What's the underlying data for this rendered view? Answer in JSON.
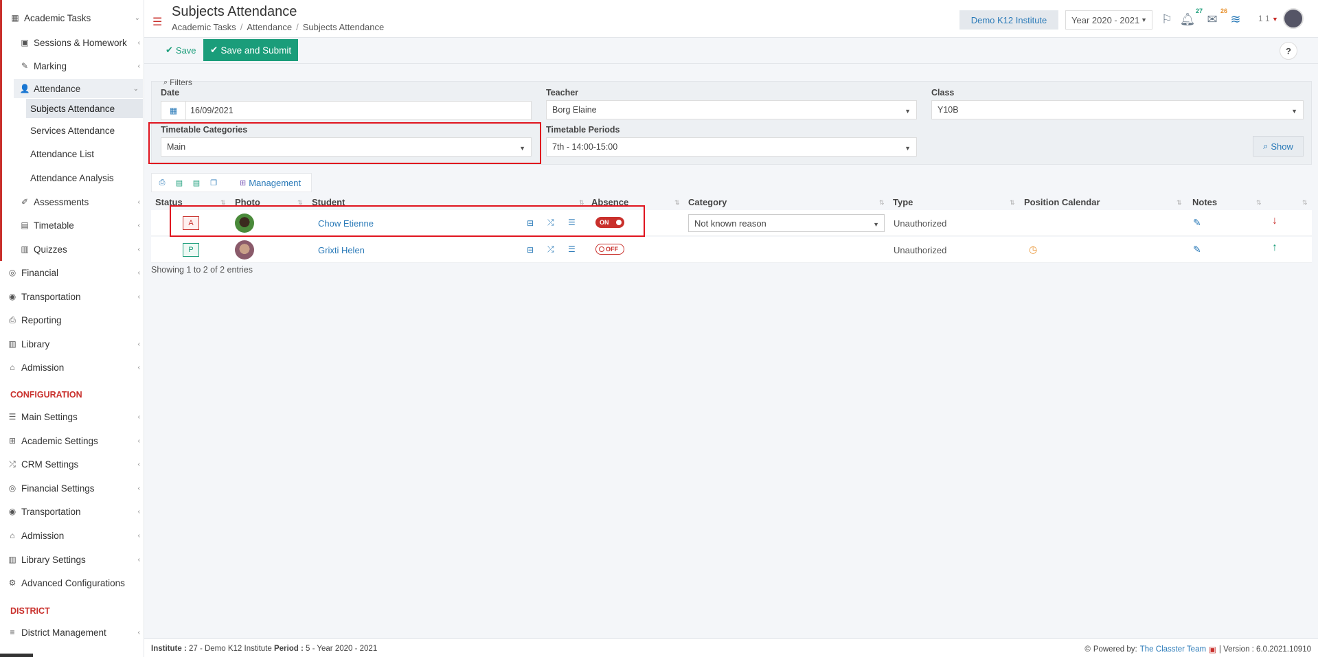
{
  "sidebar": {
    "items": [
      {
        "label": "Academic Tasks",
        "icon": "grid-icon"
      },
      {
        "label": "Sessions & Homework",
        "icon": "teacher-board-icon"
      },
      {
        "label": "Marking",
        "icon": "edit-icon"
      },
      {
        "label": "Attendance",
        "icon": "user-check-icon"
      },
      {
        "label": "Subjects Attendance"
      },
      {
        "label": "Services Attendance"
      },
      {
        "label": "Attendance List"
      },
      {
        "label": "Attendance Analysis"
      },
      {
        "label": "Assessments",
        "icon": "pencil-square-icon"
      },
      {
        "label": "Timetable",
        "icon": "table-icon"
      },
      {
        "label": "Quizzes",
        "icon": "quiz-icon"
      },
      {
        "label": "Financial",
        "icon": "coins-icon"
      },
      {
        "label": "Transportation",
        "icon": "bus-icon"
      },
      {
        "label": "Reporting",
        "icon": "printer-icon"
      },
      {
        "label": "Library",
        "icon": "books-icon"
      },
      {
        "label": "Admission",
        "icon": "building-icon"
      }
    ],
    "config_title": "CONFIGURATION",
    "config_items": [
      {
        "label": "Main Settings",
        "icon": "sliders-icon"
      },
      {
        "label": "Academic Settings",
        "icon": "hierarchy-icon"
      },
      {
        "label": "CRM Settings",
        "icon": "shuffle-icon"
      },
      {
        "label": "Financial Settings",
        "icon": "coins-icon"
      },
      {
        "label": "Transportation",
        "icon": "bus-icon"
      },
      {
        "label": "Admission",
        "icon": "building-icon"
      },
      {
        "label": "Library Settings",
        "icon": "books-icon"
      },
      {
        "label": "Advanced Configurations",
        "icon": "gears-icon"
      }
    ],
    "district_title": "DISTRICT",
    "district_items": [
      {
        "label": "District Management",
        "icon": "menu-icon"
      }
    ]
  },
  "header": {
    "title": "Subjects Attendance",
    "breadcrumb": [
      "Academic Tasks",
      "Attendance",
      "Subjects Attendance"
    ],
    "institute": "Demo K12 Institute",
    "year": "Year 2020 - 2021",
    "notif_count": "27",
    "mail_count": "26",
    "user_num": "1 1"
  },
  "actions": {
    "save": "Save",
    "save_submit": "Save and Submit",
    "help": "?"
  },
  "filters": {
    "title": "Filters",
    "date_label": "Date",
    "date_value": "16/09/2021",
    "teacher_label": "Teacher",
    "teacher_value": "Borg Elaine",
    "class_label": "Class",
    "class_value": "Y10B",
    "tt_categories_label": "Timetable Categories",
    "tt_categories_value": "Main",
    "tt_periods_label": "Timetable Periods",
    "tt_periods_value": "7th - 14:00-15:00",
    "show_button": "Show"
  },
  "table": {
    "management": "Management",
    "columns": [
      "Status",
      "Photo",
      "Student",
      "Absence",
      "Category",
      "Type",
      "Position Calendar",
      "Notes"
    ],
    "rows": [
      {
        "status": "A",
        "student": "Chow Etienne",
        "absence": "ON",
        "category": "Not known reason",
        "type": "Unauthorized"
      },
      {
        "status": "P",
        "student": "Grixti Helen",
        "absence": "OFF",
        "category": "",
        "type": "Unauthorized"
      }
    ],
    "entries": "Showing 1 to 2 of 2 entries"
  },
  "footer": {
    "institute_label": "Institute :",
    "institute_value": "27 - Demo K12 Institute",
    "period_label": "Period :",
    "period_value": "5 - Year 2020 - 2021",
    "powered_by": "Powered by:",
    "team": "The Classter Team",
    "version": "| Version : 6.0.2021.10910"
  },
  "colors": {
    "accent_red": "#c9302c",
    "primary_green": "#1a9d7a",
    "link_blue": "#2a7ab8",
    "highlight_box": "#e0141e"
  }
}
